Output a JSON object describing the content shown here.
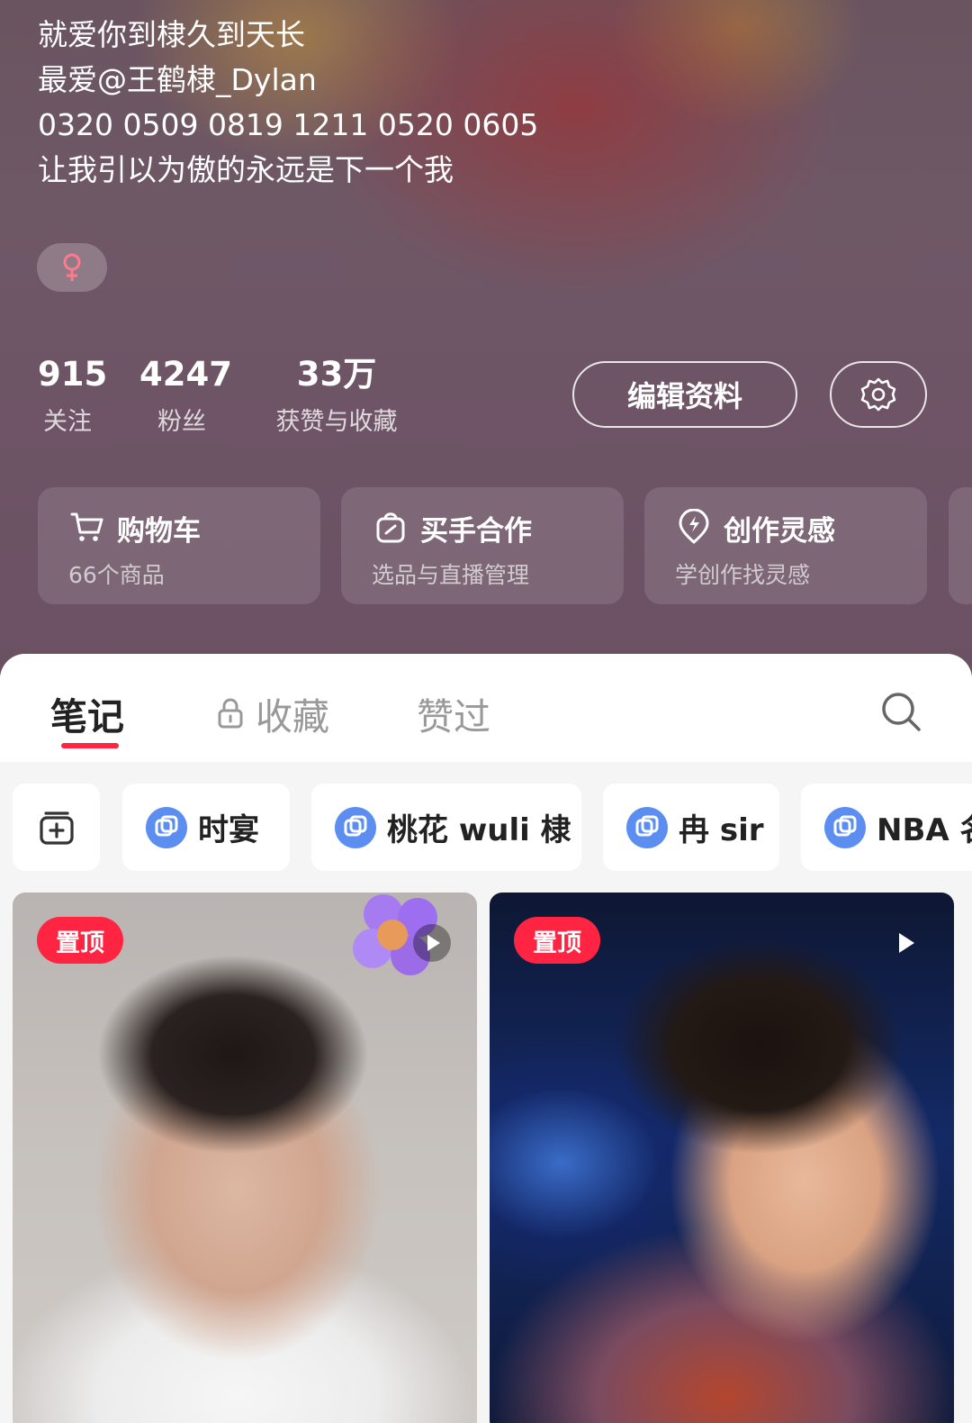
{
  "profile": {
    "bio": [
      "就爱你到棣久到天长",
      "最爱@王鹤棣_Dylan",
      "0320 0509 0819 1211  0520  0605",
      "让我引以为傲的永远是下一个我"
    ],
    "gender": "♀",
    "stats": {
      "following": {
        "value": "915",
        "label": "关注"
      },
      "followers": {
        "value": "4247",
        "label": "粉丝"
      },
      "likes": {
        "value": "33万",
        "label": "获赞与收藏"
      }
    },
    "edit_label": "编辑资料"
  },
  "cards": [
    {
      "title": "购物车",
      "subtitle": "66个商品",
      "icon": "cart-icon"
    },
    {
      "title": "买手合作",
      "subtitle": "选品与直播管理",
      "icon": "bag-icon"
    },
    {
      "title": "创作灵感",
      "subtitle": "学创作找灵感",
      "icon": "bulb-icon"
    }
  ],
  "tabs": {
    "notes": "笔记",
    "collections": "收藏",
    "liked": "赞过"
  },
  "chips": [
    "时宴",
    "桃花 wuli 棣",
    "冉 sir",
    "NBA 名"
  ],
  "posts": [
    {
      "badge": "置顶",
      "type": "video"
    },
    {
      "badge": "置顶",
      "type": "video"
    }
  ],
  "colors": {
    "accent": "#ff2442",
    "header_bg": "#6e5566",
    "album_icon": "#5b8ef0"
  }
}
